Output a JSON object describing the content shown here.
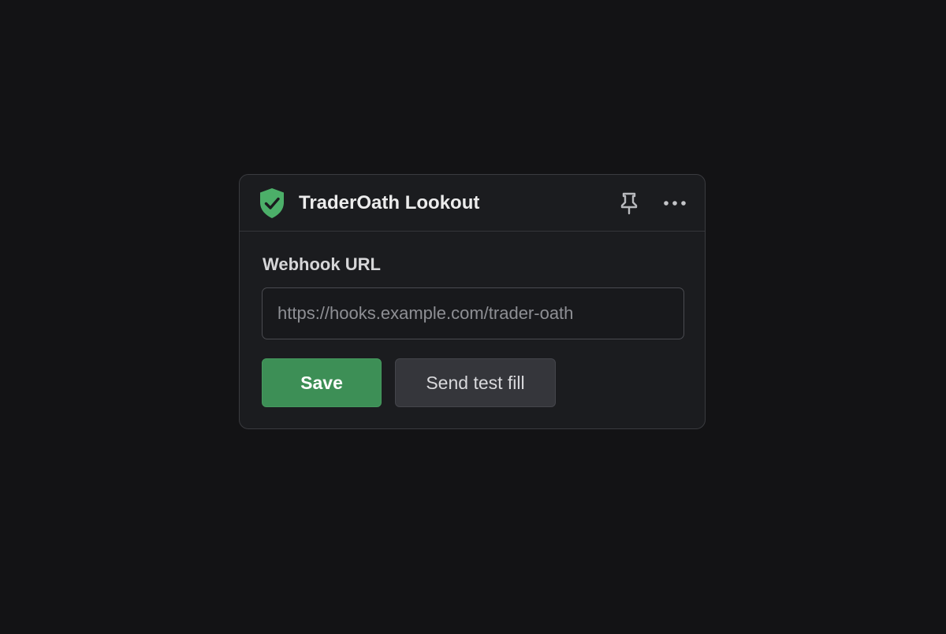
{
  "header": {
    "app_icon": "shield-check-icon",
    "title": "TraderOath Lookout",
    "pin_icon": "pin-icon",
    "more_icon": "more-horizontal-icon"
  },
  "form": {
    "label": "Webhook URL",
    "input_value": "",
    "input_placeholder": "https://hooks.example.com/trader-oath",
    "save_label": "Save",
    "test_label": "Send test fill"
  },
  "colors": {
    "background": "#131315",
    "card": "#1b1c1f",
    "accent_green": "#3d8f56",
    "shield_green": "#4caf69",
    "secondary_button": "#35363b"
  }
}
